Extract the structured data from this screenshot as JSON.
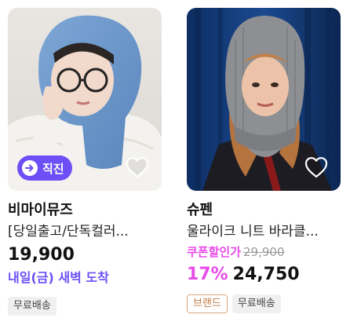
{
  "products": [
    {
      "badge": "직진",
      "brand": "비마이뮤즈",
      "name": "[당일출고/단독컬러...",
      "price": "19,900",
      "delivery": "내일(금) 새벽 도착",
      "tags": [
        "무료배송"
      ],
      "icons": {
        "badge": "arrow-right-circle-icon",
        "wish": "heart-outline-icon"
      }
    },
    {
      "brand": "슈펜",
      "name": "울라이크 니트 바라클...",
      "coupon_label": "쿠폰할인가",
      "original_price": "29,900",
      "discount": "17%",
      "price": "24,750",
      "tags": [
        "브랜드",
        "무료배송"
      ],
      "icons": {
        "wish": "heart-outline-icon"
      }
    }
  ],
  "colors": {
    "accent_purple": "#6c4ff6",
    "coupon_pink": "#e84be8",
    "brand_tag_border": "#d8a77a"
  }
}
